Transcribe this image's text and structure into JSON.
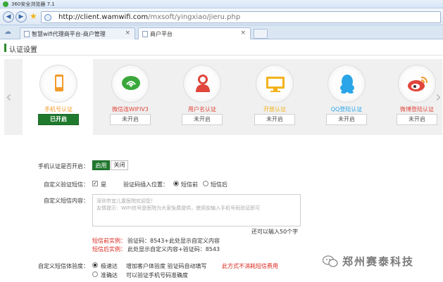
{
  "window": {
    "title": "360安全浏览器 7.1"
  },
  "address": {
    "host": "http://client.wamwifi.com",
    "path": "/mxsoft/yingxiao/jieru.php"
  },
  "tabs": [
    {
      "label": "智慧wifi代理商平台-商户管理",
      "close": "×"
    },
    {
      "label": "商户平台",
      "close": "×"
    }
  ],
  "page": {
    "section_title": "认证设置"
  },
  "channels": [
    {
      "label": "手机号认证",
      "status": "已开启",
      "enabled": true,
      "icon": "phone-icon",
      "color": "#f39a2a"
    },
    {
      "label": "微信连WIFIV3",
      "status": "未开启",
      "enabled": false,
      "icon": "wechat-icon",
      "color": "#3aa83a"
    },
    {
      "label": "用户名认证",
      "status": "未开启",
      "enabled": false,
      "icon": "user-icon",
      "color": "#e0463b"
    },
    {
      "label": "开放认证",
      "status": "未开启",
      "enabled": false,
      "icon": "monitor-icon",
      "color": "#f2b31c"
    },
    {
      "label": "QQ登陆认证",
      "status": "未开启",
      "enabled": false,
      "icon": "qq-icon",
      "color": "#2aa5e8"
    },
    {
      "label": "微博登陆认证",
      "status": "未开启",
      "enabled": false,
      "icon": "weibo-icon",
      "color": "#e0463b"
    }
  ],
  "form": {
    "enable_label": "手机认证是否开启：",
    "enable_on": "启用",
    "enable_off": "关闭",
    "sms_label": "自定义验证短信：",
    "sms_yes": "是",
    "insert_pos_label": "验证码插入位置：",
    "insert_before": "短信前",
    "insert_after": "短信后",
    "content_label": "自定义短信内容：",
    "content_line1": "深圳市宜儿童医院欢迎您！",
    "content_line2": "友情提示：WIFI信号是医院为大家免费提供，使用前输入手机号码验证即可",
    "chars_left": "还可以输入50个字",
    "example_before_label": "短信前实例：",
    "example_before_text": "验证码：8543+此处显示自定义内容",
    "example_after_label": "短信后实例：",
    "example_after_text": "此处显示自定义内容+验证码：8543",
    "experience_label": "自定义短信体验度：",
    "exp_fast": "极速达",
    "exp_fast_desc": "增加客户体验度 验证码自动填写",
    "exp_fast_warn": "此方式不消耗短信费用",
    "exp_accurate": "准确达",
    "exp_accurate_desc": "可以验证手机号码准确度"
  },
  "watermark": {
    "text": "郑州赛泰科技"
  }
}
